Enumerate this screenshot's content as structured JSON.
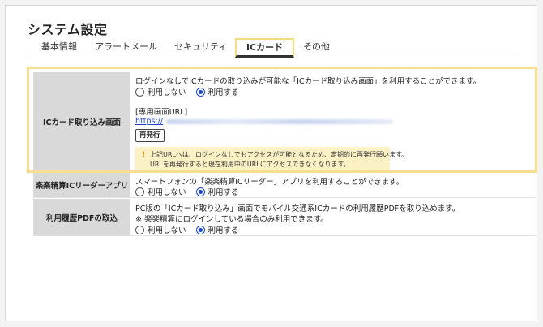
{
  "page": {
    "title": "システム設定"
  },
  "tabs": [
    {
      "label": "基本情報"
    },
    {
      "label": "アラートメール"
    },
    {
      "label": "セキュリティ"
    },
    {
      "label": "ICカード",
      "active": true
    },
    {
      "label": "その他"
    }
  ],
  "settings": {
    "ic_import_screen": {
      "label": "ICカード取り込み画面",
      "description": "ログインなしでICカードの取り込みが可能な「ICカード取り込み画面」を利用することができます。",
      "options": [
        "利用しない",
        "利用する"
      ],
      "selected": "利用する",
      "url_label": "[専用画面URL]",
      "url_prefix": "https://",
      "reissue_label": "再発行",
      "warning_icon": "!",
      "warning_line1": "上記URLへは、ログインなしでもアクセスが可能となるため、定期的に再発行願います。",
      "warning_line2": "URLを再発行すると現在利用中のURLにアクセスできなくなります。"
    },
    "ic_reader_app": {
      "label": "楽楽精算ICリーダーアプリ",
      "description": "スマートフォンの「楽楽精算ICリーダー」アプリを利用することができます。",
      "options": [
        "利用しない",
        "利用する"
      ],
      "selected": "利用する"
    },
    "usage_pdf": {
      "label": "利用履歴PDFの取込",
      "description": "PC版の「ICカード取り込み」画面でモバイル交通系ICカードの利用履歴PDFを取り込めます。",
      "note": "※ 楽楽精算にログインしている場合のみ利用できます。",
      "options": [
        "利用しない",
        "利用する"
      ],
      "selected": "利用する"
    }
  },
  "colors": {
    "highlight": "#f6e08f",
    "accent": "#1a44c9",
    "warning_bg": "#fbf1c4",
    "header_bg": "#d9d9d9"
  }
}
